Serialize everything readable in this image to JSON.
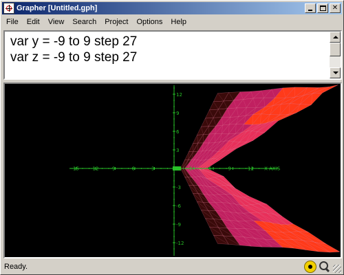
{
  "window": {
    "title": "Grapher [Untitled.gph]"
  },
  "menu": [
    "File",
    "Edit",
    "View",
    "Search",
    "Project",
    "Options",
    "Help"
  ],
  "editor": {
    "lines": [
      "var y = -9 to 9 step 27",
      "var z = -9 to 9 step 27"
    ]
  },
  "plot": {
    "x_axis_label": "X AXIS",
    "x_ticks": [
      "-15",
      "-12",
      "-9",
      "-6",
      "-3",
      "3",
      "6",
      "9",
      "12"
    ],
    "y_ticks": [
      "12",
      "9",
      "6",
      "3",
      "-3",
      "-6",
      "-9",
      "-12"
    ],
    "origin_label": "0.0",
    "axis_color": "#29c229",
    "surface_colors": [
      "#ff3a1a",
      "#e8305a",
      "#c02060",
      "#3a0a0a"
    ]
  },
  "status": {
    "text": "Ready."
  }
}
